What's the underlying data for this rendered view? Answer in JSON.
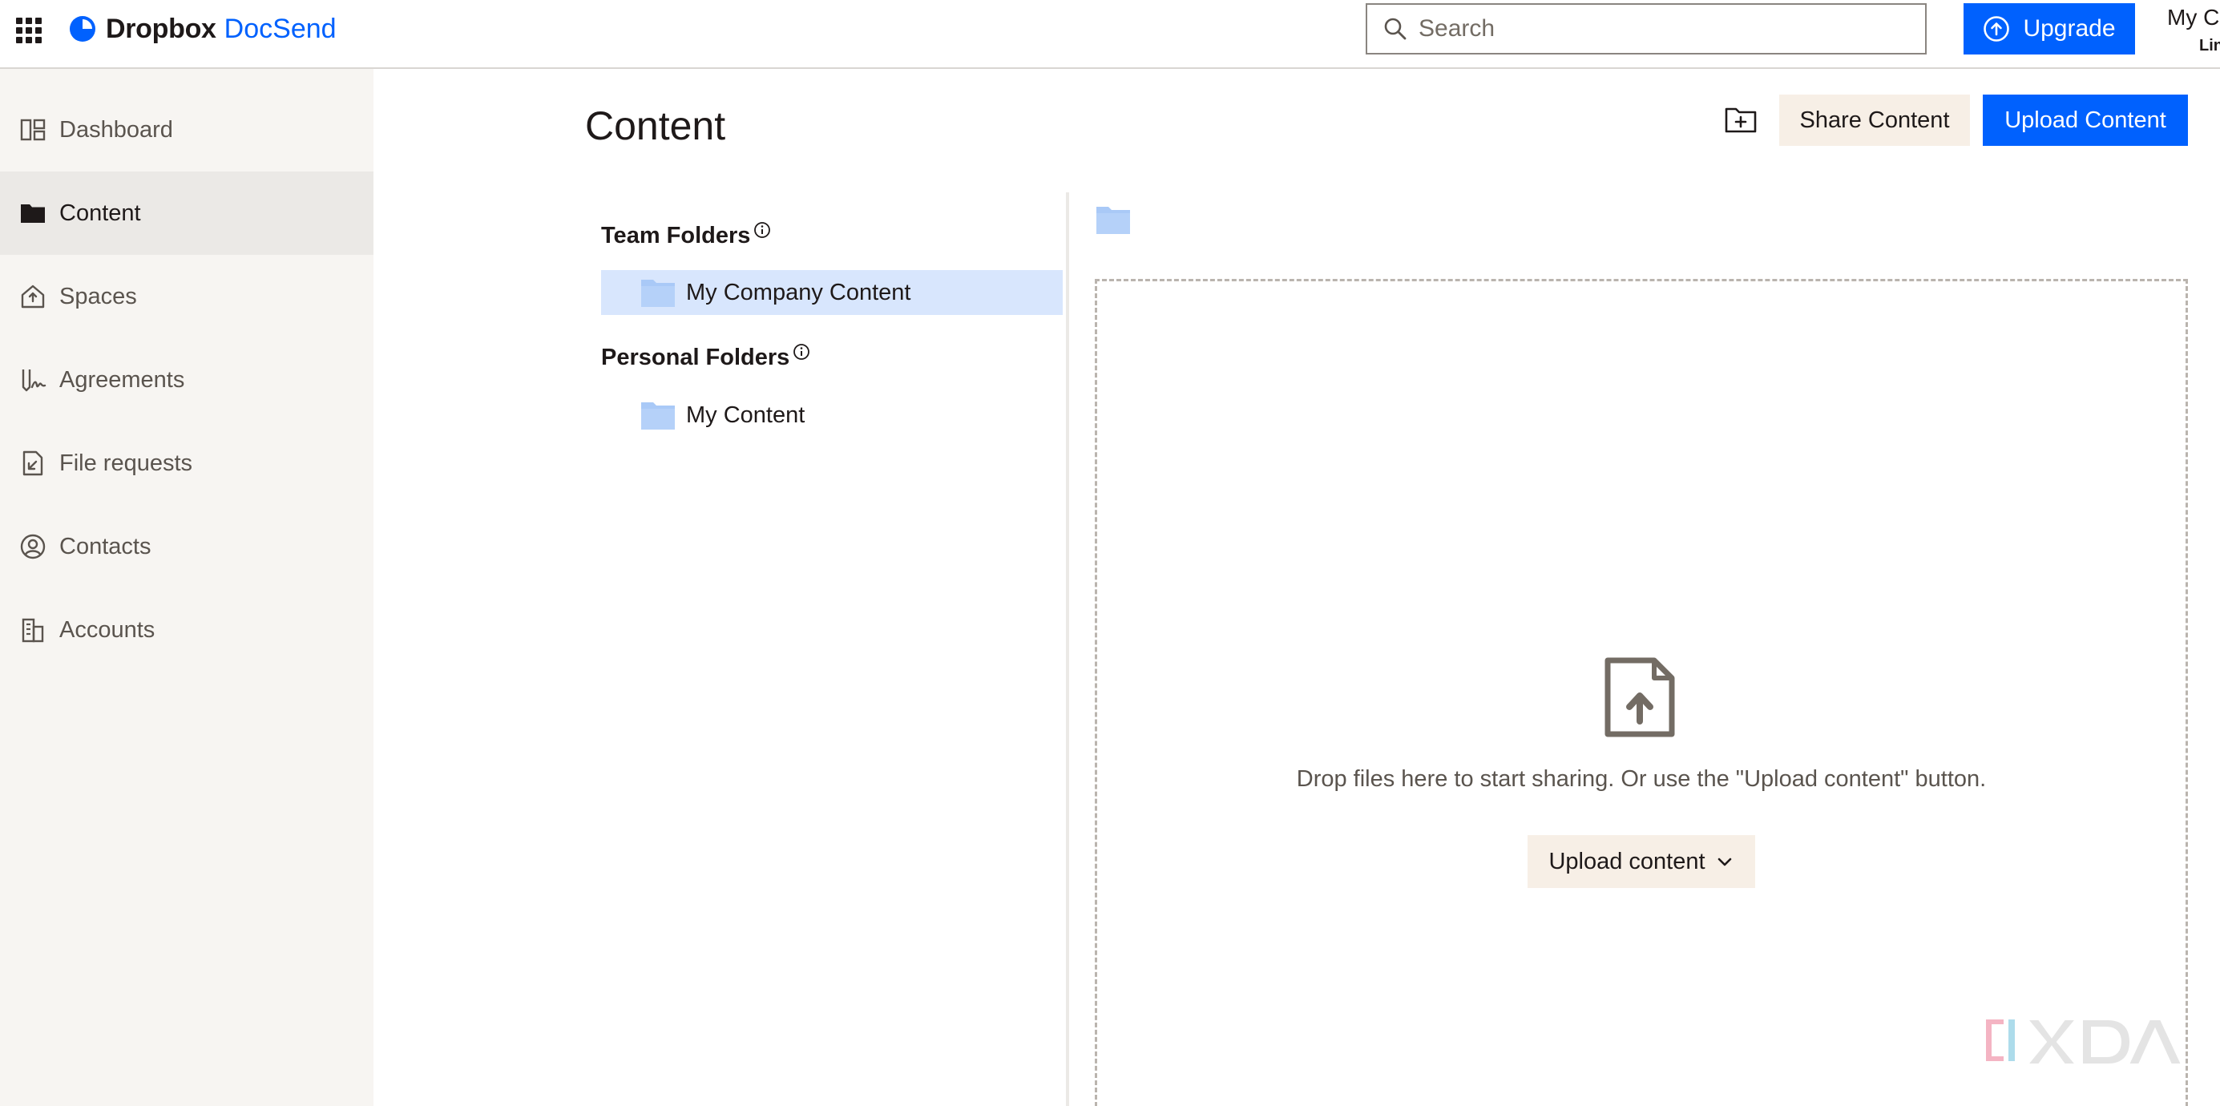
{
  "brand": {
    "name": "Dropbox",
    "product": "DocSend",
    "primary_color": "#0061fe"
  },
  "header": {
    "search_placeholder": "Search",
    "upgrade_label": "Upgrade",
    "account_name": "My C",
    "account_sub": "Lin"
  },
  "sidebar": {
    "items": [
      {
        "label": "Dashboard",
        "icon": "dashboard-icon"
      },
      {
        "label": "Content",
        "icon": "folder-icon",
        "active": true
      },
      {
        "label": "Spaces",
        "icon": "home-icon"
      },
      {
        "label": "Agreements",
        "icon": "signature-icon"
      },
      {
        "label": "File requests",
        "icon": "file-request-icon"
      },
      {
        "label": "Contacts",
        "icon": "person-circle-icon"
      },
      {
        "label": "Accounts",
        "icon": "building-icon"
      }
    ]
  },
  "main": {
    "title": "Content",
    "share_label": "Share Content",
    "upload_label": "Upload Content",
    "team_folders": {
      "title": "Team Folders",
      "items": [
        {
          "label": "My Company Content",
          "selected": true
        }
      ]
    },
    "personal_folders": {
      "title": "Personal Folders",
      "items": [
        {
          "label": "My Content"
        }
      ]
    },
    "dropzone": {
      "text": "Drop files here to start sharing. Or use the \"Upload content\" button.",
      "button_label": "Upload content"
    }
  }
}
